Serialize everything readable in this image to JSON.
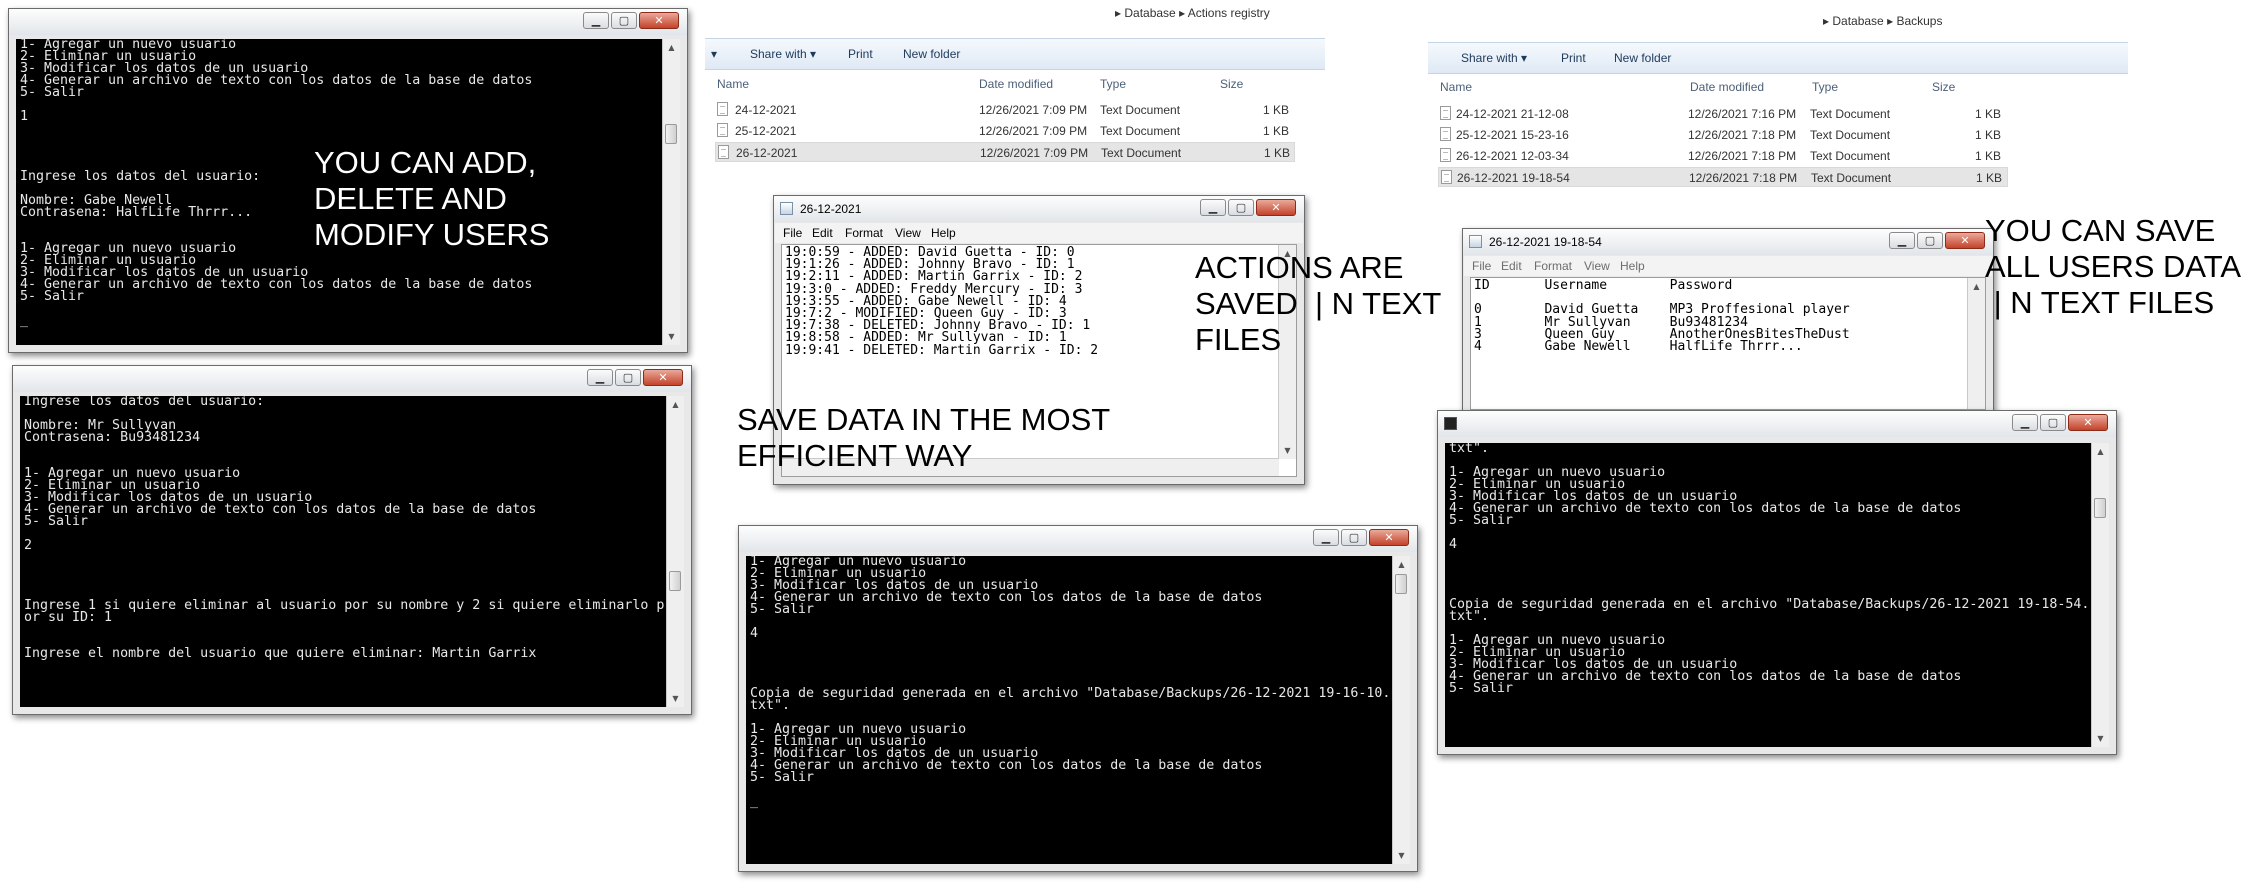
{
  "console1": {
    "text": "1- Agregar un nuevo usuario\n2- Eliminar un usuario\n3- Modificar los datos de un usuario\n4- Generar un archivo de texto con los datos de la base de datos\n5- Salir\n\n1\n\n\n\n\nIngrese los datos del usuario:\n\nNombre: Gabe Newell\nContrasena: HalfLife Thrrr...\n\n\n1- Agregar un nuevo usuario\n2- Eliminar un usuario\n3- Modificar los datos de un usuario\n4- Generar un archivo de texto con los datos de la base de datos\n5- Salir\n\n_"
  },
  "console2": {
    "text": "Ingrese los datos del usuario:\n\nNombre: Mr Sullyvan\nContrasena: Bu93481234\n\n\n1- Agregar un nuevo usuario\n2- Eliminar un usuario\n3- Modificar los datos de un usuario\n4- Generar un archivo de texto con los datos de la base de datos\n5- Salir\n\n2\n\n\n\n\nIngrese 1 si quiere eliminar al usuario por su nombre y 2 si quiere eliminarlo p\nor su ID: 1\n\n\nIngrese el nombre del usuario que quiere eliminar: Martin Garrix"
  },
  "console3": {
    "text": "1- Agregar un nuevo usuario\n2- Eliminar un usuario\n3- Modificar los datos de un usuario\n4- Generar un archivo de texto con los datos de la base de datos\n5- Salir\n\n4\n\n\n\n\nCopia de seguridad generada en el archivo \"Database/Backups/26-12-2021 19-16-10.\ntxt\".\n\n1- Agregar un nuevo usuario\n2- Eliminar un usuario\n3- Modificar los datos de un usuario\n4- Generar un archivo de texto con los datos de la base de datos\n5- Salir\n\n_"
  },
  "console4": {
    "text": "txt\".\n\n1- Agregar un nuevo usuario\n2- Eliminar un usuario\n3- Modificar los datos de un usuario\n4- Generar un archivo de texto con los datos de la base de datos\n5- Salir\n\n4\n\n\n\n\nCopia de seguridad generada en el archivo \"Database/Backups/26-12-2021 19-18-54.\ntxt\".\n\n1- Agregar un nuevo usuario\n2- Eliminar un usuario\n3- Modificar los datos de un usuario\n4- Generar un archivo de texto con los datos de la base de datos\n5- Salir"
  },
  "overlays": {
    "add_delete_modify": "YOU CAN ADD,\nDELETE AND\nMODIFY USERS",
    "actions_saved": "ACTIONS ARE\nSAVED  | N TEXT\nFILES",
    "save_efficient": "SAVE DATA IN THE MOST\nEFFICIENT WAY",
    "save_all_users": "YOU CAN SAVE\nALL USERS DATA\n | N TEXT FILES"
  },
  "explorer_actions": {
    "breadcrumb": [
      "Database",
      "Actions registry"
    ],
    "commands": [
      "Share with",
      "Print",
      "New folder"
    ],
    "columns": [
      "Name",
      "Date modified",
      "Type",
      "Size"
    ],
    "files": [
      {
        "name": "24-12-2021",
        "date": "12/26/2021 7:09 PM",
        "type": "Text Document",
        "size": "1 KB"
      },
      {
        "name": "25-12-2021",
        "date": "12/26/2021 7:09 PM",
        "type": "Text Document",
        "size": "1 KB"
      },
      {
        "name": "26-12-2021",
        "date": "12/26/2021 7:09 PM",
        "type": "Text Document",
        "size": "1 KB"
      }
    ]
  },
  "explorer_backups": {
    "breadcrumb": [
      "Database",
      "Backups"
    ],
    "commands": [
      "Share with",
      "Print",
      "New folder"
    ],
    "columns": [
      "Name",
      "Date modified",
      "Type",
      "Size"
    ],
    "files": [
      {
        "name": "24-12-2021 21-12-08",
        "date": "12/26/2021 7:16 PM",
        "type": "Text Document",
        "size": "1 KB"
      },
      {
        "name": "25-12-2021 15-23-16",
        "date": "12/26/2021 7:18 PM",
        "type": "Text Document",
        "size": "1 KB"
      },
      {
        "name": "26-12-2021 12-03-34",
        "date": "12/26/2021 7:18 PM",
        "type": "Text Document",
        "size": "1 KB"
      },
      {
        "name": "26-12-2021 19-18-54",
        "date": "12/26/2021 7:18 PM",
        "type": "Text Document",
        "size": "1 KB"
      }
    ]
  },
  "notepad_actions": {
    "title": "26-12-2021",
    "menu": [
      "File",
      "Edit",
      "Format",
      "View",
      "Help"
    ],
    "text": "19:0:59 - ADDED: David Guetta - ID: 0\n19:1:26 - ADDED: Johnny Bravo - ID: 1\n19:2:11 - ADDED: Martin Garrix - ID: 2\n19:3:0 - ADDED: Freddy Mercury - ID: 3\n19:3:55 - ADDED: Gabe Newell - ID: 4\n19:7:2 - MODIFIED: Queen Guy - ID: 3\n19:7:38 - DELETED: Johnny Bravo - ID: 1\n19:8:58 - ADDED: Mr Sullyvan - ID: 1\n19:9:41 - DELETED: Martin Garrix - ID: 2"
  },
  "notepad_backup": {
    "title": "26-12-2021 19-18-54",
    "menu": [
      "File",
      "Edit",
      "Format",
      "View",
      "Help"
    ],
    "text": "ID       Username        Password\n\n0        David Guetta    MP3 Proffesional player\n1        Mr Sullyvan     Bu93481234\n3        Queen Guy       AnotherOnesBitesTheDust\n4        Gabe Newell     HalfLife Thrrr..."
  }
}
